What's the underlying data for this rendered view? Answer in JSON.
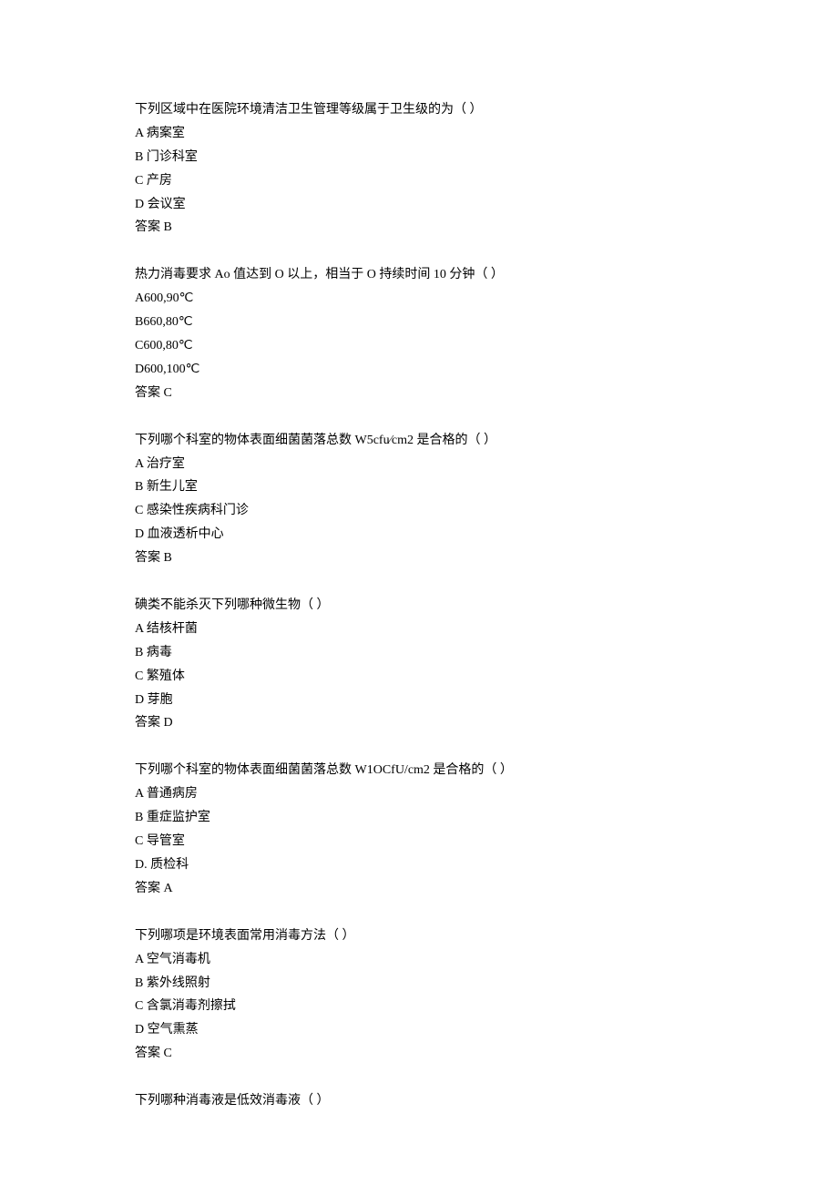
{
  "questions": [
    {
      "stem": "下列区域中在医院环境清洁卫生管理等级属于卫生级的为（ ）",
      "options": [
        "A 病案室",
        "B 门诊科室",
        "C 产房",
        "D 会议室"
      ],
      "answer": "答案 B"
    },
    {
      "stem": "热力消毒要求 Ao 值达到 O 以上，相当于 O 持续时间 10 分钟（ ）",
      "options": [
        "A600,90℃",
        "B660,80℃",
        "C600,80℃",
        "D600,100℃"
      ],
      "answer": "答案 C"
    },
    {
      "stem": "下列哪个科室的物体表面细菌菌落总数 W5cfu∕cm2 是合格的（ ）",
      "options": [
        "A 治疗室",
        "B 新生儿室",
        "C 感染性疾病科门诊",
        "D 血液透析中心"
      ],
      "answer": "答案 B"
    },
    {
      "stem": "碘类不能杀灭下列哪种微生物（ ）",
      "options": [
        "A 结核杆菌",
        "B 病毒",
        "C 繁殖体",
        "D 芽胞"
      ],
      "answer": "答案 D"
    },
    {
      "stem": "下列哪个科室的物体表面细菌菌落总数 W1OCfU/cm2 是合格的（ ）",
      "options": [
        "A 普通病房",
        "B 重症监护室",
        "C 导管室",
        "D. 质检科"
      ],
      "answer": "答案 A"
    },
    {
      "stem": "下列哪项是环境表面常用消毒方法（ ）",
      "options": [
        "A 空气消毒机",
        "B 紫外线照射",
        "C 含氯消毒剂擦拭",
        "D 空气熏蒸"
      ],
      "answer": "答案 C"
    },
    {
      "stem": "下列哪种消毒液是低效消毒液（ ）",
      "options": [],
      "answer": ""
    }
  ]
}
